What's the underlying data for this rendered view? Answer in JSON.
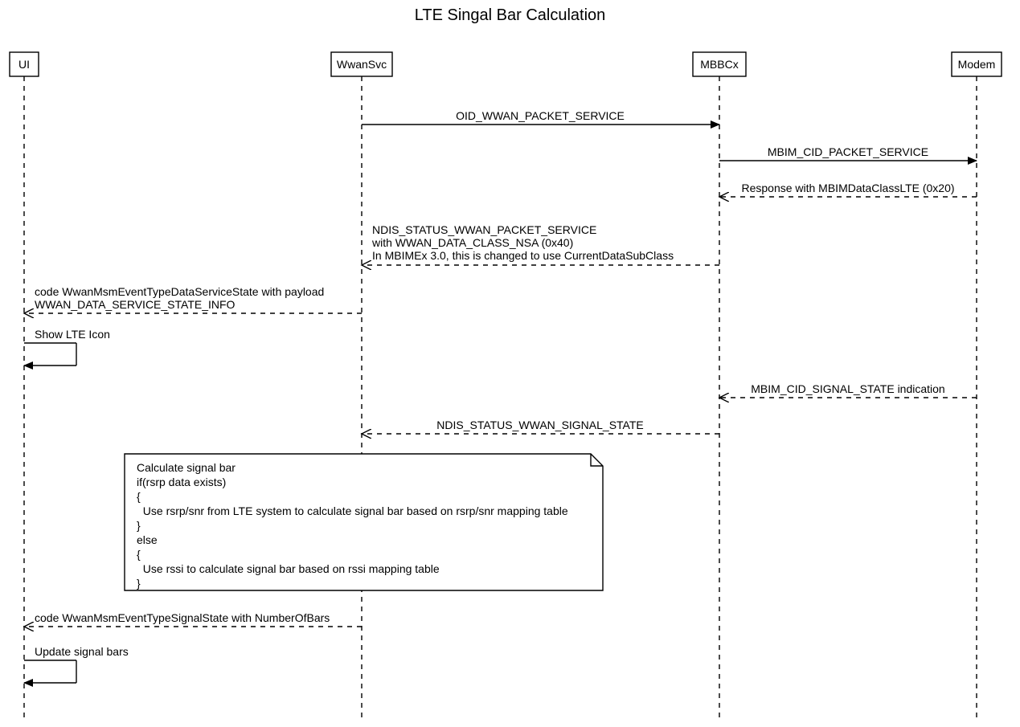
{
  "title": "LTE Singal Bar Calculation",
  "actors": {
    "ui": "UI",
    "wwansvc": "WwanSvc",
    "mbbcx": "MBBCx",
    "modem": "Modem"
  },
  "messages": {
    "m1": "OID_WWAN_PACKET_SERVICE",
    "m2": "MBIM_CID_PACKET_SERVICE",
    "m3": "Response with MBIMDataClassLTE (0x20)",
    "m4a": "NDIS_STATUS_WWAN_PACKET_SERVICE",
    "m4b": "with WWAN_DATA_CLASS_NSA (0x40)",
    "m4c": "In MBIMEx 3.0, this is changed to use CurrentDataSubClass",
    "m5a": "code WwanMsmEventTypeDataServiceState with payload",
    "m5b": "WWAN_DATA_SERVICE_STATE_INFO",
    "m6": "Show LTE Icon",
    "m7": "MBIM_CID_SIGNAL_STATE indication",
    "m8": "NDIS_STATUS_WWAN_SIGNAL_STATE",
    "m9": "code WwanMsmEventTypeSignalState with NumberOfBars",
    "m10": "Update signal bars"
  },
  "note": {
    "l1": "Calculate signal bar",
    "l2": "if(rsrp data exists)",
    "l3": "{",
    "l4": "  Use rsrp/snr from LTE system to calculate signal bar based on rsrp/snr mapping table",
    "l5": "}",
    "l6": "else",
    "l7": "{",
    "l8": "  Use rssi to calculate signal bar based on rssi mapping table",
    "l9": "}"
  }
}
